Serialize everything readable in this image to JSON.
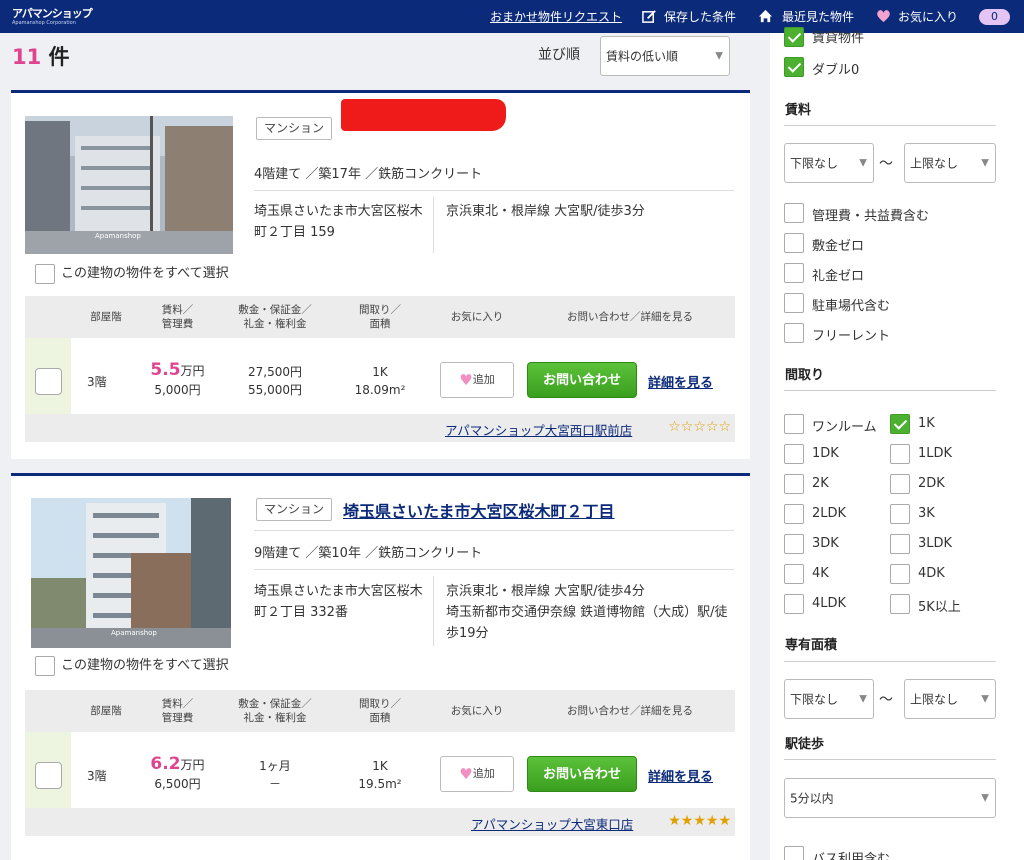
{
  "header": {
    "logo_text": "アパマンショップ",
    "logo_sub": "Apamanshop Corporation",
    "request_link": "おまかせ物件リクエスト",
    "saved": "保存した条件",
    "recent": "最近見た物件",
    "favorites": "お気に入り",
    "fav_count": "0"
  },
  "results": {
    "count": "11",
    "unit": "件",
    "sort_label": "並び順",
    "sort_value": "賃料の低い順"
  },
  "table_headers": {
    "floor": "部屋階",
    "rent_1": "賃料／",
    "rent_2": "管理費",
    "deposit_1": "敷金・保証金／",
    "deposit_2": "礼金・権利金",
    "layout_1": "間取り／",
    "layout_2": "面積",
    "fav": "お気に入り",
    "inquiry": "お問い合わせ／詳細を見る"
  },
  "labels": {
    "select_all": "この建物の物件をすべて選択",
    "fav_btn": "追加",
    "inquiry_btn": "お問い合わせ",
    "detail_link": "詳細を見る",
    "photo_watermark": "Apamanshop"
  },
  "listings": [
    {
      "type": "マンション",
      "title": "",
      "building": "4階建て ／築17年 ／鉄筋コンクリート",
      "address": "埼玉県さいたま市大宮区桜木町２丁目 159",
      "stations": [
        "京浜東北・根岸線 大宮駅/徒歩3分"
      ],
      "unit": {
        "floor": "3階",
        "rent_num": "5.5",
        "rent_unit": "万円",
        "mgmt": "5,000円",
        "deposit": "27,500円",
        "key_money": "55,000円",
        "layout": "1K",
        "area": "18.09m²"
      },
      "shop": "アパマンショップ大宮西口駅前店",
      "stars": "☆☆☆☆☆",
      "stars_color": "#e0a100"
    },
    {
      "type": "マンション",
      "title": "埼玉県さいたま市大宮区桜木町２丁目",
      "building": "9階建て ／築10年 ／鉄筋コンクリート",
      "address": "埼玉県さいたま市大宮区桜木町２丁目 332番",
      "stations": [
        "京浜東北・根岸線 大宮駅/徒歩4分",
        "埼玉新都市交通伊奈線 鉄道博物館（大成）駅/徒歩19分"
      ],
      "unit": {
        "floor": "3階",
        "rent_num": "6.2",
        "rent_unit": "万円",
        "mgmt": "6,500円",
        "deposit": "1ヶ月",
        "key_money": "－",
        "layout": "1K",
        "area": "19.5m²"
      },
      "shop": "アパマンショップ大宮東口店",
      "stars": "★★★★★",
      "stars_color": "#e0a100"
    }
  ],
  "sidebar": {
    "top_checks": [
      {
        "label": "賃貸物件",
        "checked": true
      },
      {
        "label": "ダブル0",
        "checked": true
      }
    ],
    "rent_heading": "賃料",
    "rent_min": "下限なし",
    "rent_max": "上限なし",
    "tilde": "～",
    "rent_options": [
      {
        "label": "管理費・共益費含む",
        "checked": false
      },
      {
        "label": "敷金ゼロ",
        "checked": false
      },
      {
        "label": "礼金ゼロ",
        "checked": false
      },
      {
        "label": "駐車場代含む",
        "checked": false
      },
      {
        "label": "フリーレント",
        "checked": false
      }
    ],
    "layout_heading": "間取り",
    "layouts": [
      {
        "label": "ワンルーム",
        "checked": false
      },
      {
        "label": "1K",
        "checked": true
      },
      {
        "label": "1DK",
        "checked": false
      },
      {
        "label": "1LDK",
        "checked": false
      },
      {
        "label": "2K",
        "checked": false
      },
      {
        "label": "2DK",
        "checked": false
      },
      {
        "label": "2LDK",
        "checked": false
      },
      {
        "label": "3K",
        "checked": false
      },
      {
        "label": "3DK",
        "checked": false
      },
      {
        "label": "3LDK",
        "checked": false
      },
      {
        "label": "4K",
        "checked": false
      },
      {
        "label": "4DK",
        "checked": false
      },
      {
        "label": "4LDK",
        "checked": false
      },
      {
        "label": "5K以上",
        "checked": false
      }
    ],
    "area_heading": "専有面積",
    "area_min": "下限なし",
    "area_max": "上限なし",
    "walk_heading": "駅徒歩",
    "walk_value": "5分以内",
    "bus_label": "バス利用含む"
  },
  "colors": {
    "brand_navy": "#0c2a7a",
    "accent_pink": "#e0448e",
    "inquiry_green": "#4cb030"
  }
}
